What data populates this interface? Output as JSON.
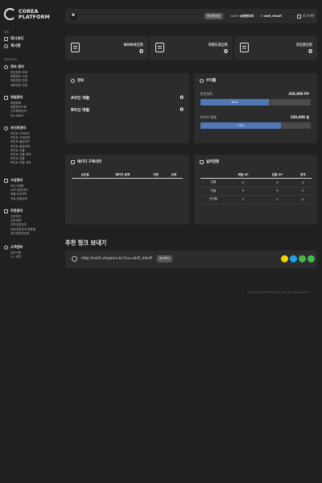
{
  "brand": {
    "line1": "COREA",
    "line2": "PLATFORM"
  },
  "sidebar": {
    "group1": "메인",
    "dashboard": "대시보드",
    "board": "게시판",
    "group2": "마이리포트",
    "sections": [
      {
        "title": "정보 관리",
        "icon": "gear-icon",
        "items": [
          "본인정보 조회",
          "회원정보 수정",
          "비밀번호 변경",
          "계좌번호 변경"
        ]
      },
      {
        "title": "회원관리",
        "icon": "users-icon",
        "items": [
          "회원등록",
          "회원정보조회",
          "산하회원검색",
          "박스계보도"
        ]
      },
      {
        "title": "포인트관리",
        "icon": "coin-icon",
        "items": [
          "포인트 구매하기",
          "포인트 구매내역",
          "포인트 출금하기",
          "포인트 출금내역",
          "포인트 선물",
          "포인트 선물 내역",
          "포인트 전환",
          "포인트 전환 내역"
        ]
      },
      {
        "title": "수당관리",
        "icon": "wallet-icon",
        "items": [
          "보너스현황",
          "나의 현금내역",
          "매출수당내역",
          "직급 현황정보"
        ]
      },
      {
        "title": "주문관리",
        "icon": "cart-icon",
        "items": [
          "주문하기",
          "주문내역",
          "산하주문검색",
          "산하주문검색 회원별",
          "재고매주문검색"
        ]
      },
      {
        "title": "고객센터",
        "icon": "headset-icon",
        "items": [
          "공지사항",
          "1:1 문의"
        ]
      }
    ]
  },
  "topbar": {
    "avatar": "N",
    "badge": "판매원계정",
    "name_label": "NAME",
    "name_value": "승폐관리재",
    "id_label": "ID",
    "id_value": "dnfl_rhksfl",
    "logout": "로그아웃"
  },
  "points": [
    {
      "label": "NOW포인트",
      "value": "0"
    },
    {
      "label": "리워드포인트",
      "value": "0"
    },
    {
      "label": "코인포인트",
      "value": "0"
    }
  ],
  "info": {
    "title": "정보",
    "rows": [
      {
        "label": "A라인 매출",
        "value": "0"
      },
      {
        "label": "B라인 매출",
        "value": "0"
      }
    ]
  },
  "revenue": {
    "title": "수익률",
    "items": [
      {
        "label": "본인실적",
        "value": "330,000 PV",
        "percent": "62%",
        "fill": 62
      },
      {
        "label": "보너스 발생",
        "value": "180,000 원",
        "percent": "73%",
        "fill": 73
      }
    ]
  },
  "package": {
    "title": "패키지 구매내역",
    "headers": [
      "승인일",
      "패키지 금액",
      "지점",
      "상태"
    ]
  },
  "performance": {
    "title": "실적현황",
    "headers": [
      "",
      "매출 SP",
      "반품 SP",
      "합계"
    ],
    "rows": [
      [
        "당월",
        "0",
        "0",
        "0"
      ],
      [
        "전월",
        "0",
        "0",
        "0"
      ],
      [
        "전전월",
        "0",
        "0",
        "0"
      ]
    ]
  },
  "referral": {
    "title": "추천 링크 보내기",
    "url": "http://net5.shoptics.kr/?cu=dnfl_rhksfl",
    "copy": "링크복사"
  },
  "colors": {
    "bar_fill": "#4f78b4",
    "kakao": "#f5d000",
    "twitter": "#1da1f2",
    "band": "#49b749",
    "line": "#3ac14a"
  },
  "footer": "Copyright (C) NET Shoptics Co.,Ltd. All rights reserved."
}
